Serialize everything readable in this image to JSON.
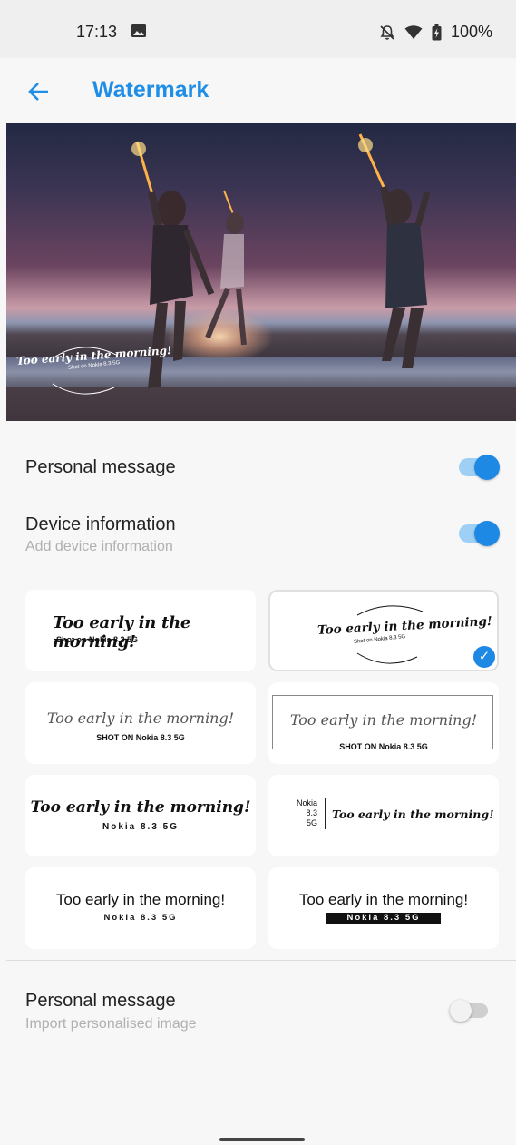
{
  "status_bar": {
    "time": "17:13",
    "battery": "100%",
    "icons": [
      "gallery-icon",
      "mute-icon",
      "wifi-icon",
      "battery-icon"
    ]
  },
  "app_bar": {
    "back_icon": "arrow-left-icon",
    "title": "Watermark",
    "accent_color": "#1f8ee6"
  },
  "preview": {
    "watermark_text": "Too early in the morning!",
    "watermark_sub": "Shot on Nokia 8.3 5G"
  },
  "settings": {
    "personal_message": {
      "label": "Personal message",
      "on": true
    },
    "device_information": {
      "label": "Device information",
      "sub": "Add device information",
      "on": true
    }
  },
  "styles": [
    {
      "text": "Too early in the morning!",
      "sub": "Shot on Nokia 8.3 5G",
      "selected": false
    },
    {
      "text": "Too early in the morning!",
      "sub": "Shot on Nokia 8.3 5G",
      "selected": true
    },
    {
      "text": "Too early in the morning!",
      "sub": "SHOT ON Nokia 8.3 5G",
      "selected": false
    },
    {
      "text": "Too early in the morning!",
      "sub": "SHOT ON Nokia 8.3 5G",
      "selected": false
    },
    {
      "text": "Too early in the morning!",
      "sub": "Nokia 8.3 5G",
      "selected": false
    },
    {
      "text": "Too early in the morning!",
      "sub_lines": [
        "Nokia",
        "8.3",
        "5G"
      ],
      "selected": false
    },
    {
      "text": "Too early in the morning!",
      "sub": "Nokia 8.3 5G",
      "selected": false
    },
    {
      "text": "Too early in the morning!",
      "sub": "Nokia 8.3 5G",
      "selected": false
    }
  ],
  "personal_image": {
    "label": "Personal message",
    "sub": "Import personalised image",
    "on": false
  },
  "toggle_color": "#1e88e5"
}
